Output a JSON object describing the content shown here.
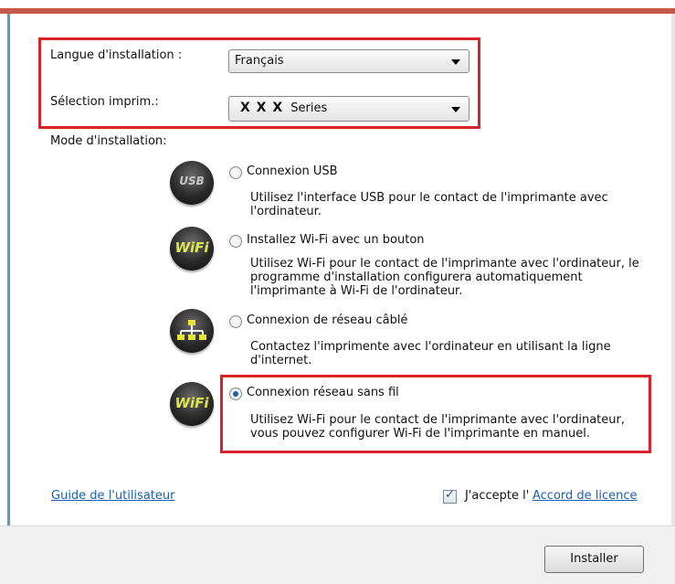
{
  "install_language": {
    "label": "Langue d'installation :",
    "selected": "Français"
  },
  "printer_selection": {
    "label": "Sélection imprim.:",
    "selected_prefix": "X X X",
    "selected_suffix": "Series"
  },
  "install_mode": {
    "label": "Mode d'installation:",
    "options": [
      {
        "icon": "usb-icon",
        "icon_text": "USB",
        "title": "Connexion USB",
        "desc_lines": [
          "Utilisez  l'interface USB pour le contact de l'imprimante  avec",
          "l'ordinateur."
        ],
        "selected": false
      },
      {
        "icon": "wifi-icon",
        "icon_text": "WiFi",
        "title": "Installez Wi-Fi avec un bouton",
        "desc_lines": [
          "Utilisez Wi-Fi pour le contact de l'imprimante avec l'ordinateur, le",
          "programme d'installation configurera automatiquement",
          "l'imprimante  à Wi-Fi de l'ordinateur."
        ],
        "selected": false
      },
      {
        "icon": "network-icon",
        "icon_text": "",
        "title": "Connexion de réseau câblé",
        "desc_lines": [
          "Contactez l'imprimente avec l'ordinateur en utilisant la ligne",
          "d'internet."
        ],
        "selected": false
      },
      {
        "icon": "wifi-icon",
        "icon_text": "WiFi",
        "title": "Connexion réseau sans fil",
        "desc_lines": [
          "Utilisez Wi-Fi pour le contact de l'imprimante avec l'ordinateur,",
          "vous pouvez configurer Wi-Fi de l'imprimante en manuel."
        ],
        "selected": true
      }
    ]
  },
  "footer": {
    "user_guide_link": "Guide de l'utilisateur",
    "accept_prefix": "J'accepte l'",
    "license_link": "Accord de licence",
    "accept_checked": true,
    "install_button": "Installer"
  },
  "colors": {
    "highlight_border": "#d8232a",
    "link": "#1a5fb4",
    "wifi_text": "#dfe84a"
  }
}
